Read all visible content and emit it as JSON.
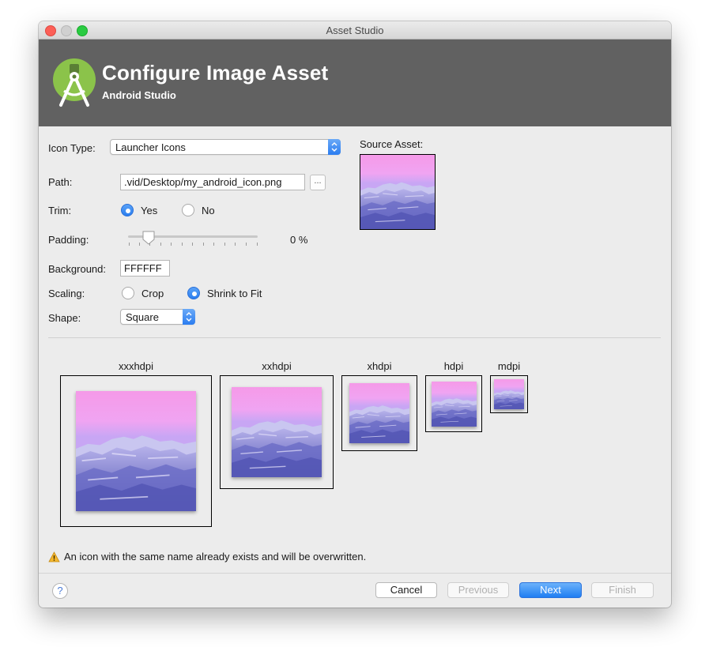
{
  "window": {
    "title": "Asset Studio"
  },
  "banner": {
    "title": "Configure Image Asset",
    "subtitle": "Android Studio"
  },
  "form": {
    "icon_type_label": "Icon Type:",
    "icon_type_value": "Launcher Icons",
    "source_asset_label": "Source Asset:",
    "path_label": "Path:",
    "path_value": ".vid/Desktop/my_android_icon.png",
    "browse_label": "...",
    "trim_label": "Trim:",
    "trim_yes": "Yes",
    "trim_no": "No",
    "trim_selected": "Yes",
    "padding_label": "Padding:",
    "padding_value": "0 %",
    "padding_percent": 0,
    "background_label": "Background:",
    "background_value": "FFFFFF",
    "scaling_label": "Scaling:",
    "scaling_crop": "Crop",
    "scaling_shrink": "Shrink to Fit",
    "scaling_selected": "Shrink to Fit",
    "shape_label": "Shape:",
    "shape_value": "Square"
  },
  "previews": [
    {
      "label": "xxxhdpi"
    },
    {
      "label": "xxhdpi"
    },
    {
      "label": "xhdpi"
    },
    {
      "label": "hdpi"
    },
    {
      "label": "mdpi"
    }
  ],
  "warning": {
    "icon": "warning-icon",
    "text": "An icon with the same name already exists and will be overwritten."
  },
  "footer": {
    "help_label": "?",
    "cancel_label": "Cancel",
    "previous_label": "Previous",
    "next_label": "Next",
    "finish_label": "Finish"
  },
  "colors": {
    "accent": "#2b7df0",
    "banner": "#616161",
    "android_green": "#8bc34a"
  }
}
